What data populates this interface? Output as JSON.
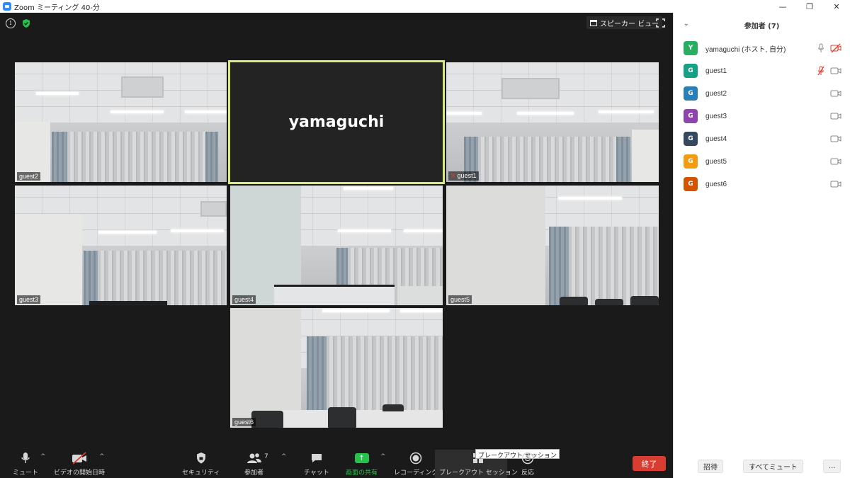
{
  "window": {
    "title": "Zoom ミーティング 40-分",
    "minimize": "—",
    "restore": "❐",
    "close": "✕"
  },
  "stage": {
    "speaker_view_label": "スピーカー ビュー",
    "active_speaker": "yamaguchi",
    "tiles": [
      {
        "name": "guest2"
      },
      {
        "name": "guest1"
      },
      {
        "name": "guest3"
      },
      {
        "name": "guest4"
      },
      {
        "name": "guest5"
      },
      {
        "name": "guest6"
      }
    ]
  },
  "toolbar": {
    "mute": "ミュート",
    "video": "ビデオの開始日時",
    "security": "セキュリティ",
    "participants": "参加者",
    "participants_count": "7",
    "chat": "チャット",
    "share": "画面の共有",
    "record": "レコーディング",
    "breakout": "ブレークアウト セッション",
    "breakout_tooltip": "ブレークアウト セッション",
    "reactions": "反応",
    "end": "終了"
  },
  "panel": {
    "title": "参加者 (7)",
    "participants": [
      {
        "initial": "Y",
        "name": "yamaguchi (ホスト, 自分)",
        "color": "#27ae60"
      },
      {
        "initial": "G",
        "name": "guest1",
        "color": "#16a085"
      },
      {
        "initial": "G",
        "name": "guest2",
        "color": "#2980b9"
      },
      {
        "initial": "G",
        "name": "guest3",
        "color": "#8e44ad"
      },
      {
        "initial": "G",
        "name": "guest4",
        "color": "#34495e"
      },
      {
        "initial": "G",
        "name": "guest5",
        "color": "#f39c12"
      },
      {
        "initial": "G",
        "name": "guest6",
        "color": "#d35400"
      }
    ],
    "invite": "招待",
    "mute_all": "すべてミュート",
    "more": "..."
  }
}
